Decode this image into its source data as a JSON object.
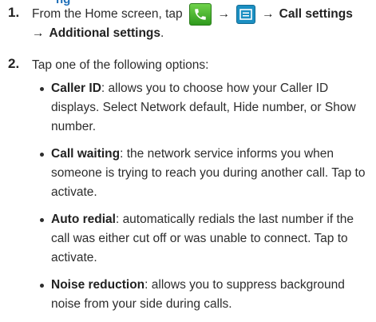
{
  "top_sliver": "ng",
  "step1": {
    "number": "1.",
    "text_before": "From the Home screen, tap",
    "arrow1": "→",
    "arrow2": "→",
    "menu_path": "Call settings",
    "arrow3": "→",
    "submenu": "Additional settings",
    "period": ".",
    "icons": [
      "phone-icon",
      "menu-icon"
    ],
    "colors": {
      "phone_icon": "#3aa828",
      "menu_icon": "#1b8fc2"
    }
  },
  "step2": {
    "number": "2.",
    "text": "Tap one of the following options:"
  },
  "options": [
    {
      "title": "Caller ID",
      "description": ": allows you to choose how your Caller ID displays. Select Network default, Hide number, or Show number."
    },
    {
      "title": "Call waiting",
      "description": ": the network service informs you when someone is trying to reach you during another call. Tap to activate."
    },
    {
      "title": "Auto redial",
      "description": ": automatically redials the last number if the call was either cut off or was unable to connect. Tap to activate."
    },
    {
      "title": "Noise reduction",
      "description": ": allows you to suppress background noise from your side during calls."
    }
  ]
}
